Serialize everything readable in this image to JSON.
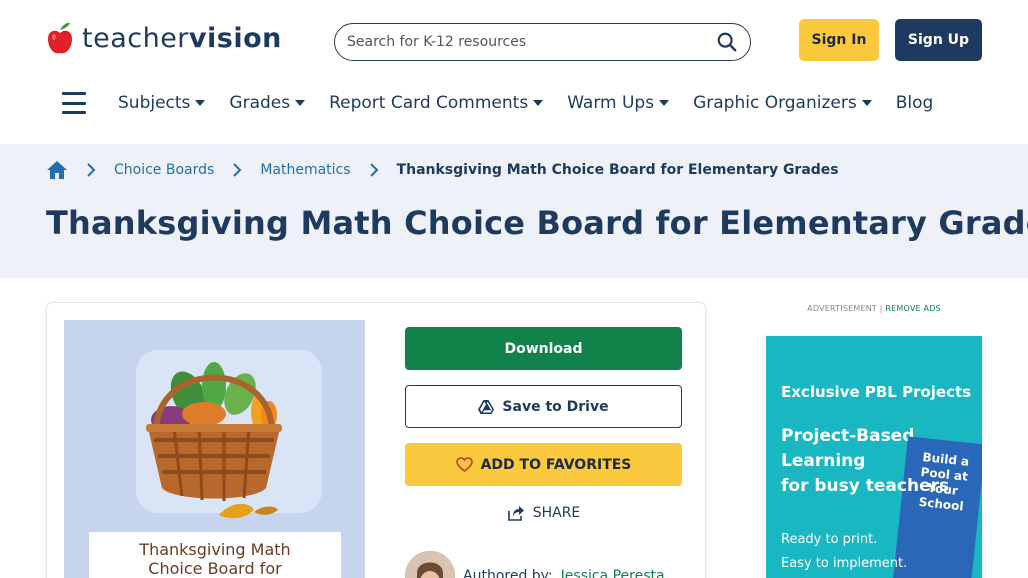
{
  "header": {
    "logo_text_light": "teacher",
    "logo_text_bold": "vision",
    "search_placeholder": "Search for K-12 resources",
    "sign_in_label": "Sign In",
    "sign_up_label": "Sign Up"
  },
  "nav": {
    "items": [
      {
        "label": "Subjects",
        "has_dropdown": true
      },
      {
        "label": "Grades",
        "has_dropdown": true
      },
      {
        "label": "Report Card Comments",
        "has_dropdown": true
      },
      {
        "label": "Warm Ups",
        "has_dropdown": true
      },
      {
        "label": "Graphic Organizers",
        "has_dropdown": true
      },
      {
        "label": "Blog",
        "has_dropdown": false
      }
    ]
  },
  "breadcrumb": {
    "home_icon": "home-icon",
    "items": [
      "Choice Boards",
      "Mathematics"
    ],
    "current": "Thanksgiving Math Choice Board for Elementary Grades"
  },
  "page": {
    "title": "Thanksgiving Math Choice Board for Elementary Grades"
  },
  "resource": {
    "thumbnail_caption_line1": "Thanksgiving Math",
    "thumbnail_caption_line2": "Choice Board for",
    "download_label": "Download",
    "save_drive_label": "Save to Drive",
    "favorites_label": "ADD TO FAVORITES",
    "share_label": "SHARE",
    "authored_by_label": "Authored by:",
    "author_name": "Jessica Peresta"
  },
  "ad": {
    "label": "ADVERTISEMENT |",
    "remove_label": "REMOVE ADS",
    "kicker": "Exclusive PBL Projects",
    "headline_line1": "Project-Based",
    "headline_line2": "Learning",
    "headline_line3": "for busy teachers",
    "sub_line1": "Ready to print.",
    "sub_line2": "Easy to implement.",
    "book_title": "Build a Pool at Your School"
  },
  "colors": {
    "brand_navy": "#1f3a5f",
    "brand_yellow": "#fbc93d",
    "brand_green": "#12824b",
    "link_blue": "#1f6fb2",
    "hero_bg": "#eef2f8",
    "ad_teal": "#19b7c2"
  }
}
